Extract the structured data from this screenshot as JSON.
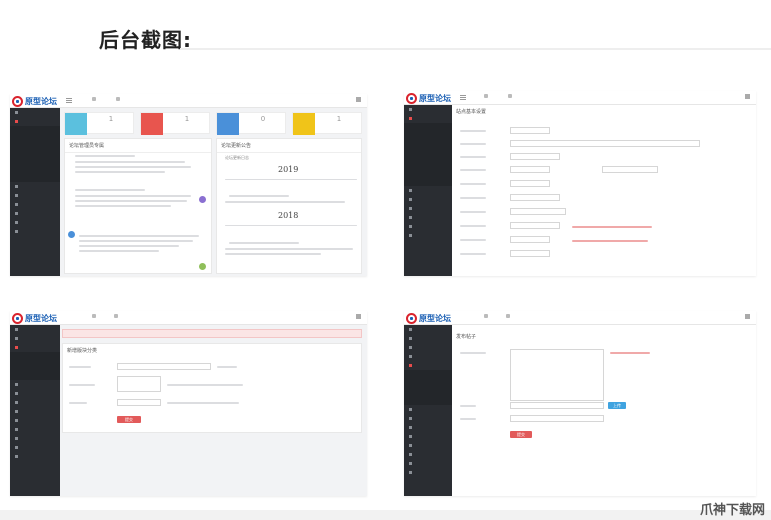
{
  "heading": "后台截图:",
  "watermark": "爪神下载网",
  "brand": "原型论坛",
  "shot1": {
    "stats": [
      {
        "value": "1",
        "color": "#5bc0de"
      },
      {
        "value": "1",
        "color": "#e8554e"
      },
      {
        "value": "0",
        "color": "#4a90d9"
      },
      {
        "value": "1",
        "color": "#f0c419"
      }
    ],
    "left_panel_title": "论坛管理员专属",
    "right_panel_title": "论坛更新公告",
    "right_panel_sub": "论坛更新日志",
    "years": [
      "2019",
      "2018"
    ]
  },
  "shot2": {
    "panel_title": "站点基本设置"
  },
  "shot3": {
    "panel_title": "新增版块分类",
    "submit": "提交"
  },
  "shot4": {
    "panel_title": "发布帖子",
    "upload": "上传",
    "submit": "提交"
  },
  "colors": {
    "accent_red": "#e25a5a",
    "sidebar_bg": "#2a2d32",
    "brand_blue": "#1a5fb4"
  }
}
